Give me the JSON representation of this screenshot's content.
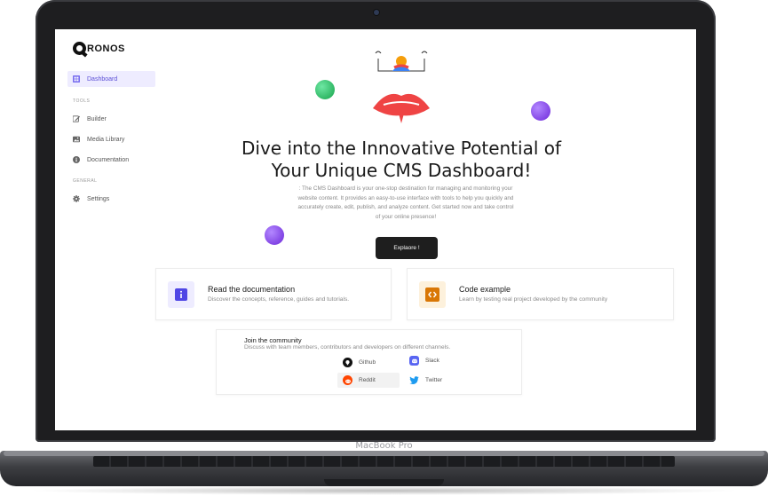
{
  "device": {
    "model_label": "MacBook Pro"
  },
  "app": {
    "logo_text": "RONOS"
  },
  "sidebar": {
    "items": [
      {
        "label": "Dashboard",
        "icon": "dashboard-icon",
        "active": true
      }
    ],
    "sections": [
      {
        "label": "TOOLS",
        "items": [
          {
            "label": "Builder",
            "icon": "pencil-icon"
          },
          {
            "label": "Media Library",
            "icon": "image-icon"
          },
          {
            "label": "Documentation",
            "icon": "info-icon"
          }
        ]
      },
      {
        "label": "GENERAL",
        "items": [
          {
            "label": "Settings",
            "icon": "gear-icon"
          }
        ]
      }
    ]
  },
  "hero": {
    "title_line1": "Dive into the Innovative Potential of",
    "title_line2": "Your Unique CMS Dashboard!",
    "description": ": The CMS Dashboard is your one-stop destination for managing and monitoring your website content. It provides an easy-to-use interface with tools to help you quickly and accurately create, edit, publish, and analyze content. Get started now and take control of your online presence!",
    "cta_label": "Explaore !"
  },
  "cards": [
    {
      "title": "Read the documentation",
      "subtitle": "Discover the concepts, reference, guides and tutorials.",
      "icon": "info-icon",
      "accent": "#4f46e5"
    },
    {
      "title": "Code example",
      "subtitle": "Learn by testing real project developed by the community",
      "icon": "code-icon",
      "accent": "#d97706"
    }
  ],
  "community": {
    "title": "Join the community",
    "description": "Discuss with team members, contributors and developers on different channels.",
    "links": [
      {
        "label": "Github",
        "icon": "github-icon",
        "color": "#111111"
      },
      {
        "label": "Slack",
        "icon": "discord-icon",
        "color": "#5865f2"
      },
      {
        "label": "Reddit",
        "icon": "reddit-icon",
        "color": "#ff4500"
      },
      {
        "label": "Twitter",
        "icon": "twitter-icon",
        "color": "#1d9bf0"
      }
    ]
  },
  "colors": {
    "accent": "#5b4fd6",
    "sidebar_active_bg": "#eeecff",
    "cta_bg": "#1e1e1e",
    "orb_green": "#22c55e",
    "orb_purple": "#7c3aed",
    "hero_red": "#ef4444"
  }
}
